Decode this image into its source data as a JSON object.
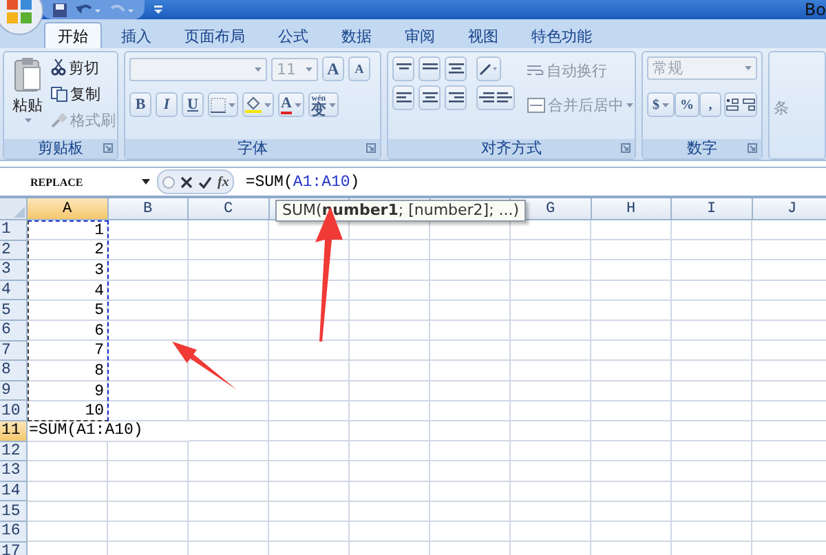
{
  "title_bar": {
    "title": "Bo"
  },
  "tabs": [
    {
      "label": "开始",
      "selected": true
    },
    {
      "label": "插入",
      "selected": false
    },
    {
      "label": "页面布局",
      "selected": false
    },
    {
      "label": "公式",
      "selected": false
    },
    {
      "label": "数据",
      "selected": false
    },
    {
      "label": "审阅",
      "selected": false
    },
    {
      "label": "视图",
      "selected": false
    },
    {
      "label": "特色功能",
      "selected": false
    }
  ],
  "ribbon": {
    "clipboard": {
      "paste": "粘贴",
      "label": "剪贴板",
      "items": [
        {
          "label": "剪切",
          "disabled": false
        },
        {
          "label": "复制",
          "disabled": false
        },
        {
          "label": "格式刷",
          "disabled": true
        }
      ]
    },
    "font": {
      "font_size": "11",
      "grow": "A",
      "shrink": "A",
      "buttons": [
        "B",
        "I",
        "U"
      ],
      "font_color": "A",
      "phonetic_ruby": "wén",
      "phonetic_char": "变",
      "label": "字体"
    },
    "alignment": {
      "wrap_text": "自动换行",
      "merge_center": "合并后居中",
      "label": "对齐方式"
    },
    "number": {
      "format": "常规",
      "buttons": [
        "$",
        "%",
        ","
      ],
      "label": "数字"
    },
    "styles": {
      "label": "条"
    }
  },
  "formula_bar": {
    "name_box": "REPLACE",
    "fx": "fx",
    "formula": [
      {
        "kind": "text",
        "text": "=SUM("
      },
      {
        "kind": "reference",
        "text": "A1:A10"
      },
      {
        "kind": "text",
        "text": ")"
      }
    ]
  },
  "tooltip": "SUM(**number1**; [number2]; ...)",
  "sheet": {
    "copy_marquee": true,
    "columns": [
      {
        "label": "A",
        "selected": true
      },
      {
        "label": "B",
        "selected": false
      },
      {
        "label": "C",
        "selected": false
      },
      {
        "selected": false
      },
      {
        "selected": false
      },
      {
        "selected": false
      },
      {
        "label": "G",
        "selected": false
      },
      {
        "label": "H",
        "selected": false
      },
      {
        "label": "I",
        "selected": false
      },
      {
        "label": "J",
        "selected": false
      }
    ],
    "rows": [
      {
        "label": "1",
        "selected": false,
        "a": "1"
      },
      {
        "label": "2",
        "selected": false,
        "a": "2"
      },
      {
        "label": "3",
        "selected": false,
        "a": "3"
      },
      {
        "label": "4",
        "selected": false,
        "a": "4"
      },
      {
        "label": "5",
        "selected": false,
        "a": "5"
      },
      {
        "label": "6",
        "selected": false,
        "a": "6"
      },
      {
        "label": "7",
        "selected": false,
        "a": "7"
      },
      {
        "label": "8",
        "selected": false,
        "a": "8"
      },
      {
        "label": "9",
        "selected": false,
        "a": "9"
      },
      {
        "label": "10",
        "selected": false,
        "a": "10"
      },
      {
        "label": "11",
        "selected": true,
        "a": "=SUM(A1:A10)",
        "kind": "editing"
      },
      {
        "label": "12",
        "selected": false
      },
      {
        "label": "13",
        "selected": false
      },
      {
        "label": "14",
        "selected": false
      },
      {
        "label": "15",
        "selected": false
      },
      {
        "label": "16",
        "selected": false
      },
      {
        "label": "17",
        "selected": false
      }
    ]
  }
}
